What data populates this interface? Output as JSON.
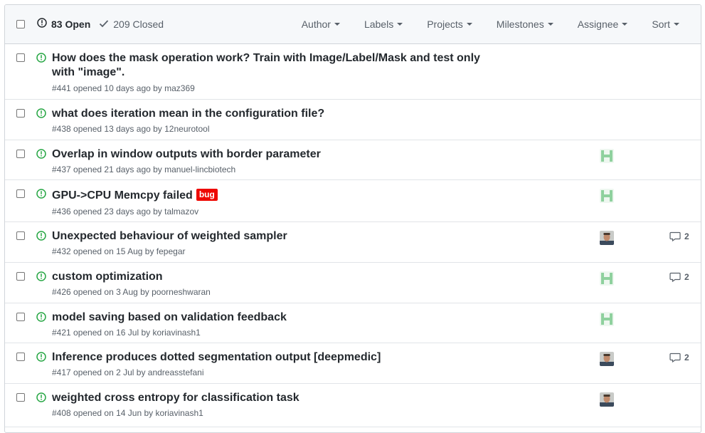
{
  "header": {
    "open_count": "83 Open",
    "closed_count": "209 Closed",
    "filters": [
      "Author",
      "Labels",
      "Projects",
      "Milestones",
      "Assignee",
      "Sort"
    ]
  },
  "issues": [
    {
      "title_line1": "How does the mask operation work? Train with Image/Label/Mask and test only",
      "title_line2": "with \"image\".",
      "meta": "#441 opened 10 days ago by maz369"
    },
    {
      "title": "what does iteration mean in the configuration file?",
      "meta": "#438 opened 13 days ago by 12neurotool"
    },
    {
      "title": "Overlap in window outputs with border parameter",
      "meta": "#437 opened 21 days ago by manuel-lincbiotech",
      "avatar": "green-identicon"
    },
    {
      "title": "GPU->CPU Memcpy failed",
      "label": "bug",
      "meta": "#436 opened 23 days ago by talmazov",
      "avatar": "green-identicon"
    },
    {
      "title": "Unexpected behaviour of weighted sampler",
      "meta": "#432 opened on 15 Aug by fepegar",
      "avatar": "photo",
      "comments": "2"
    },
    {
      "title": "custom optimization",
      "meta": "#426 opened on 3 Aug by poorneshwaran",
      "avatar": "green-identicon",
      "comments": "2"
    },
    {
      "title": "model saving based on validation feedback",
      "meta": "#421 opened on 16 Jul by koriavinash1",
      "avatar": "green-identicon"
    },
    {
      "title": "Inference produces dotted segmentation output [deepmedic]",
      "meta": "#417 opened on 2 Jul by andreasstefani",
      "avatar": "photo",
      "comments": "2"
    },
    {
      "title": "weighted cross entropy for classification task",
      "meta": "#408 opened on 14 Jun by koriavinash1",
      "avatar": "photo"
    }
  ],
  "colors": {
    "open_green": "#28a745",
    "bug_label": "#ee0701",
    "identicon": "#8fd19e"
  }
}
